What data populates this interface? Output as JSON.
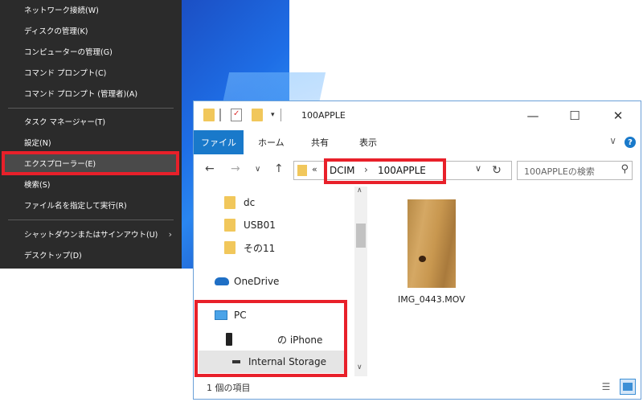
{
  "context_menu": {
    "items": [
      {
        "label": "ネットワーク接続(W)"
      },
      {
        "label": "ディスクの管理(K)"
      },
      {
        "label": "コンピューターの管理(G)"
      },
      {
        "label": "コマンド プロンプト(C)"
      },
      {
        "label": "コマンド プロンプト (管理者)(A)"
      },
      {
        "label": "タスク マネージャー(T)"
      },
      {
        "label": "設定(N)"
      },
      {
        "label": "エクスプローラー(E)"
      },
      {
        "label": "検索(S)"
      },
      {
        "label": "ファイル名を指定して実行(R)"
      },
      {
        "label": "シャットダウンまたはサインアウト(U)"
      },
      {
        "label": "デスクトップ(D)"
      }
    ],
    "highlighted": "エクスプローラー(E)",
    "submenu_arrow": "›"
  },
  "explorer": {
    "title": "100APPLE",
    "window_buttons": {
      "minimize": "—",
      "maximize": "☐",
      "close": "✕"
    },
    "ribbon_tabs": [
      "ファイル",
      "ホーム",
      "共有",
      "表示"
    ],
    "help": "?",
    "ribbon_expand": "∨",
    "nav": {
      "back": "←",
      "forward": "→",
      "recent": "∨",
      "up": "↑"
    },
    "address": {
      "prefix": "«",
      "segments": [
        "DCIM",
        "100APPLE"
      ],
      "separator": "›",
      "dropdown": "∨",
      "refresh": "↻"
    },
    "search": {
      "placeholder": "100APPLEの検索",
      "icon": "⚲"
    },
    "tree": {
      "folders": [
        "dc",
        "USB01",
        "その11"
      ],
      "onedrive": "OneDrive",
      "pc": "PC",
      "iphone": "の iPhone",
      "storage": "Internal Storage"
    },
    "files": [
      {
        "name": "IMG_0443.MOV"
      }
    ],
    "status": "1 個の項目",
    "scroll": {
      "up": "∧",
      "down": "∨"
    }
  },
  "colors": {
    "menu_bg": "#2b2b2b",
    "highlight_red": "#e8202a",
    "accent_blue": "#1979ca",
    "folder_yellow": "#f1c75b"
  }
}
